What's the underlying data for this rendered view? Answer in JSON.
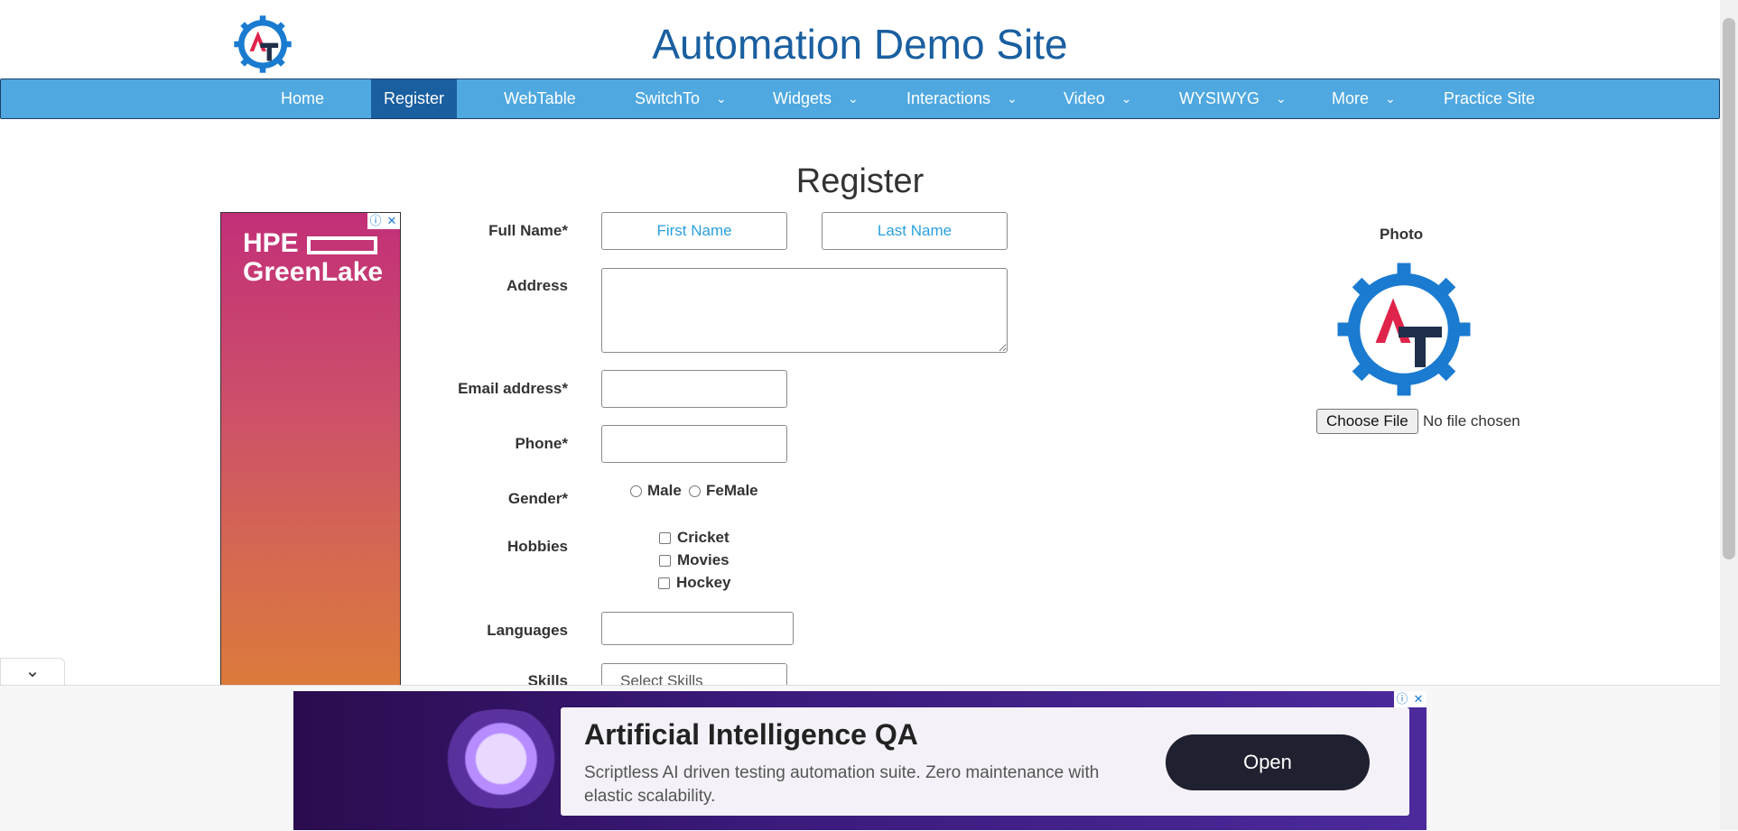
{
  "header": {
    "site_title": "Automation Demo Site"
  },
  "nav": {
    "items": [
      {
        "label": "Home",
        "dropdown": false,
        "active": false
      },
      {
        "label": "Register",
        "dropdown": false,
        "active": true
      },
      {
        "label": "WebTable",
        "dropdown": false,
        "active": false
      },
      {
        "label": "SwitchTo",
        "dropdown": true,
        "active": false
      },
      {
        "label": "Widgets",
        "dropdown": true,
        "active": false
      },
      {
        "label": "Interactions",
        "dropdown": true,
        "active": false
      },
      {
        "label": "Video",
        "dropdown": true,
        "active": false
      },
      {
        "label": "WYSIWYG",
        "dropdown": true,
        "active": false
      },
      {
        "label": "More",
        "dropdown": true,
        "active": false
      },
      {
        "label": "Practice Site",
        "dropdown": false,
        "active": false
      }
    ],
    "chevron": "⌄"
  },
  "form": {
    "title": "Register",
    "full_name_label": "Full Name*",
    "first_name_placeholder": "First Name",
    "last_name_placeholder": "Last Name",
    "address_label": "Address",
    "email_label": "Email address*",
    "phone_label": "Phone*",
    "gender_label": "Gender*",
    "gender_male": "Male",
    "gender_female": "FeMale",
    "hobbies_label": "Hobbies",
    "hobby_cricket": "Cricket",
    "hobby_movies": "Movies",
    "hobby_hockey": "Hockey",
    "languages_label": "Languages",
    "skills_label": "Skills",
    "skills_placeholder": "Select Skills"
  },
  "photo": {
    "label": "Photo",
    "button": "Choose File",
    "status": "No file chosen"
  },
  "side_ad": {
    "brand_line1": "HPE",
    "brand_line2": "GreenLake",
    "info_icon": "ⓘ",
    "close_icon": "✕"
  },
  "bottom_ad": {
    "title": "Artificial Intelligence QA",
    "description": "Scriptless AI driven testing automation suite. Zero maintenance with elastic scalability.",
    "button": "Open",
    "info_icon": "ⓘ",
    "close_icon": "✕"
  },
  "collapse_icon": "⌄",
  "colors": {
    "nav_bg": "#4fa8e0",
    "nav_active": "#1a5fa0",
    "title_blue": "#1a5fa0",
    "placeholder_blue": "#2aa0de",
    "logo_blue": "#1a7bd0",
    "logo_red": "#e0234a"
  }
}
